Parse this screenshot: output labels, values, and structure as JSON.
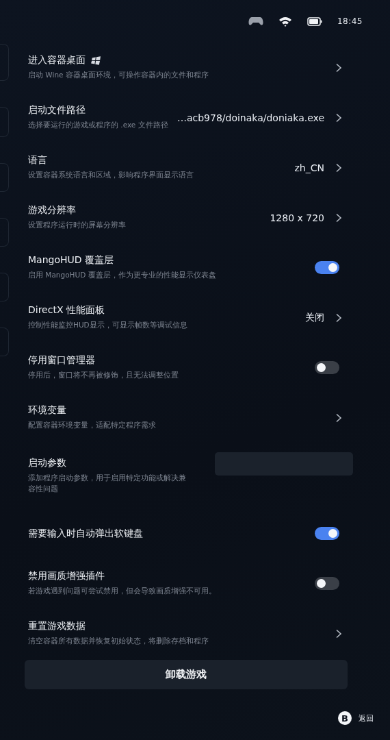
{
  "status_bar": {
    "time": "18:45"
  },
  "settings": [
    {
      "kind": "chevron",
      "title": "进入容器桌面",
      "windows_icon": true,
      "subtitle": "启动 Wine 容器桌面环境，可操作容器内的文件和程序"
    },
    {
      "kind": "chevron",
      "title": "启动文件路径",
      "subtitle": "选择要运行的游戏或程序的 .exe 文件路径",
      "value": "…acb978/doinaka/doniaka.exe"
    },
    {
      "kind": "chevron",
      "title": "语言",
      "subtitle": "设置容器系统语言和区域，影响程序界面显示语言",
      "value": "zh_CN"
    },
    {
      "kind": "chevron",
      "title": "游戏分辨率",
      "subtitle": "设置程序运行时的屏幕分辨率",
      "value": "1280 x 720"
    },
    {
      "kind": "toggle",
      "title": "MangoHUD 覆盖层",
      "subtitle": "启用 MangoHUD 覆盖层，作为更专业的性能显示仪表盘",
      "on": true
    },
    {
      "kind": "chevron",
      "title": "DirectX 性能面板",
      "subtitle": "控制性能监控HUD显示，可显示帧数等调试信息",
      "value": "关闭"
    },
    {
      "kind": "toggle",
      "title": "停用窗口管理器",
      "subtitle": "停用后，窗口将不再被修饰，且无法调整位置",
      "on": false
    },
    {
      "kind": "chevron",
      "title": "环境变量",
      "subtitle": "配置容器环境变量，适配特定程序需求"
    },
    {
      "kind": "input",
      "title": "启动参数",
      "subtitle": "添加程序启动参数，用于启用特定功能或解决兼容性问题"
    },
    {
      "kind": "toggle",
      "title": "需要输入时自动弹出软键盘",
      "on": true
    },
    {
      "kind": "toggle",
      "title": "禁用画质增强插件",
      "subtitle": "若游戏遇到问题可尝试禁用，但会导致画质增强不可用。",
      "on": false
    },
    {
      "kind": "chevron",
      "title": "重置游戏数据",
      "subtitle": "清空容器所有数据并恢复初始状态，将删除存档和程序"
    }
  ],
  "uninstall_button": "卸载游戏",
  "back_hint": {
    "key": "B",
    "label": "返回"
  }
}
